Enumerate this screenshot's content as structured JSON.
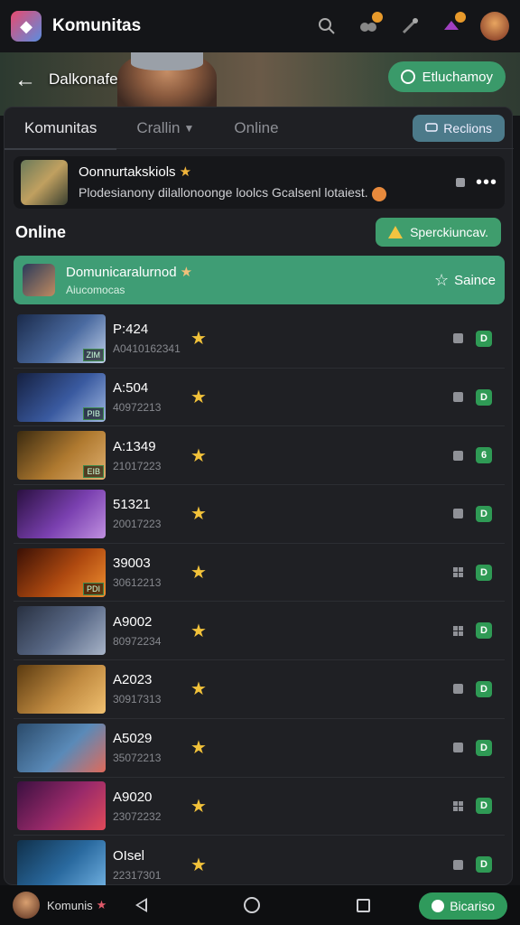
{
  "appbar": {
    "title": "Komunitas",
    "icons": [
      "search-icon",
      "gamepad-icon",
      "wand-icon",
      "notification-icon",
      "profile-avatar"
    ]
  },
  "hero": {
    "back_label": "Dalkonafe",
    "pill_label": "Etluchamoy"
  },
  "tabs": [
    {
      "label": "Komunitas"
    },
    {
      "label": "Crallin"
    },
    {
      "label": "Online"
    }
  ],
  "tabs_right_button": "Reclions",
  "featured": {
    "title": "Oonnurtakskiols",
    "subtitle": "Plodesianony dilallonoonge loolcs Gcalsenl lotaiest."
  },
  "online_section": {
    "title": "Online",
    "button_label": "Sperckiuncav."
  },
  "highlight": {
    "title": "Domunicaralurnod",
    "subtitle": "Aiucomocas",
    "action_label": "Saince"
  },
  "rows": [
    {
      "title": "P:424",
      "sub": "A0410162341",
      "tag": "ZIM",
      "badge": "D",
      "right": "square"
    },
    {
      "title": "A:504",
      "sub": "40972213",
      "tag": "PIB",
      "badge": "D",
      "right": "square"
    },
    {
      "title": "A:1349",
      "sub": "21017223",
      "tag": "EIB",
      "badge": "6",
      "right": "square"
    },
    {
      "title": "51321",
      "sub": "20017223",
      "tag": "",
      "badge": "D",
      "right": "square"
    },
    {
      "title": "39003",
      "sub": "30612213",
      "tag": "PDI",
      "badge": "D",
      "right": "grid"
    },
    {
      "title": "A9002",
      "sub": "80972234",
      "tag": "",
      "badge": "D",
      "right": "grid"
    },
    {
      "title": "A2023",
      "sub": "30917313",
      "tag": "",
      "badge": "D",
      "right": "square"
    },
    {
      "title": "A5029",
      "sub": "35072213",
      "tag": "",
      "badge": "D",
      "right": "square"
    },
    {
      "title": "A9020",
      "sub": "23072232",
      "tag": "",
      "badge": "D",
      "right": "grid"
    },
    {
      "title": "OIsel",
      "sub": "22317301",
      "tag": "",
      "badge": "D",
      "right": "square"
    }
  ],
  "thumb_colors": [
    [
      "#1a2a4a",
      "#4a6aa0",
      "#c0d0e8"
    ],
    [
      "#152040",
      "#3a5aa0",
      "#a0b8e0"
    ],
    [
      "#3a2a10",
      "#b07a30",
      "#e0b070"
    ],
    [
      "#2a1040",
      "#7a40b0",
      "#c090e0"
    ],
    [
      "#3a1005",
      "#b04a10",
      "#f09030"
    ],
    [
      "#283040",
      "#5a6a88",
      "#a8b4c8"
    ],
    [
      "#5a3a10",
      "#c08a40",
      "#f0c070"
    ],
    [
      "#2a4a6a",
      "#5a8ab8",
      "#e06a5a"
    ],
    [
      "#3a1040",
      "#9a2a6a",
      "#e04a5a"
    ],
    [
      "#10304a",
      "#2a6aa0",
      "#70b0e0"
    ]
  ],
  "bottombar": {
    "label": "Komunis",
    "button_label": "Bicariso"
  }
}
